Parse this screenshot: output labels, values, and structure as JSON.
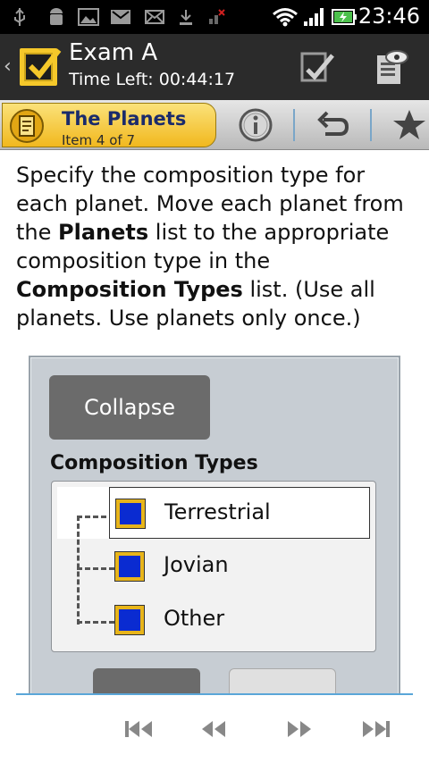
{
  "status_bar": {
    "time": "23:46",
    "icons": [
      "usb-icon",
      "android-debug-icon",
      "image-icon",
      "gmail-icon",
      "email-icon",
      "download-icon",
      "no-signal-icon",
      "wifi-icon",
      "signal-bars-icon",
      "battery-charging-icon"
    ]
  },
  "action_bar": {
    "exam_title": "Exam A",
    "time_left": "Time Left: 00:44:17",
    "buttons": [
      "mark-check-icon",
      "review-notes-icon"
    ]
  },
  "item_bar": {
    "title": "The Planets",
    "subtitle": "Item 4 of 7",
    "buttons": [
      "info-icon",
      "undo-icon",
      "star-icon"
    ]
  },
  "question": {
    "part1": "Specify the composition type for each planet. Move each planet from the ",
    "bold1": "Planets",
    "part2": " list to the appropriate composition type in the ",
    "bold2": "Composition Types",
    "part3": " list. (Use all planets. Use planets only once.)"
  },
  "panel": {
    "collapse_label": "Collapse",
    "composition_label": "Composition Types",
    "tree_items": [
      {
        "label": "Terrestrial",
        "selected": true
      },
      {
        "label": "Jovian",
        "selected": false
      },
      {
        "label": "Other",
        "selected": false
      }
    ]
  },
  "bottom_nav": [
    "first-icon",
    "previous-icon",
    "next-icon",
    "last-icon"
  ],
  "colors": {
    "accent_gold": "#f1b81e",
    "tree_check_blue": "#0a2bd1",
    "divider_blue": "#5aa6d8"
  }
}
